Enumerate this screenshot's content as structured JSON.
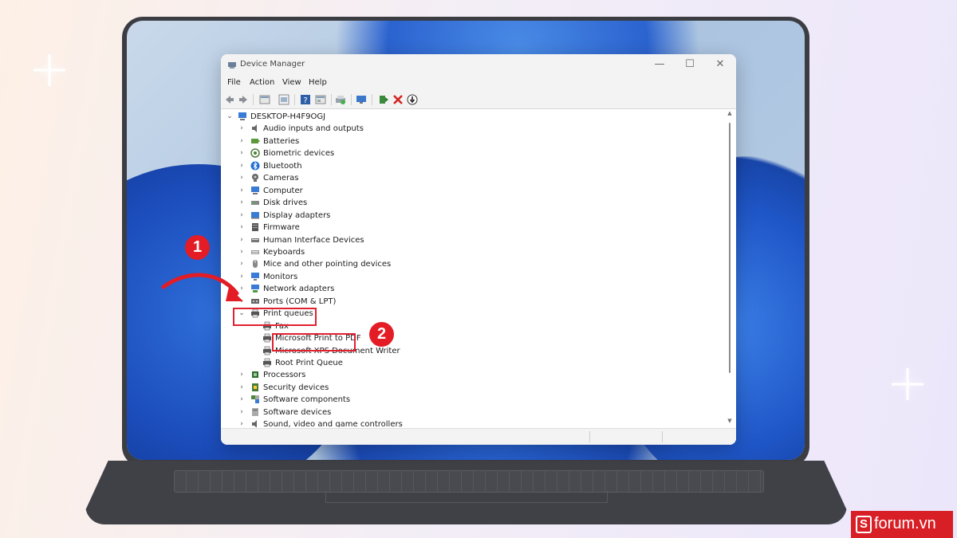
{
  "window": {
    "title": "Device Manager",
    "controls": {
      "minimize": "—",
      "maximize": "☐",
      "close": "✕"
    }
  },
  "menu": [
    "File",
    "Action",
    "View",
    "Help"
  ],
  "toolbar_icons": [
    "back-arrow-icon",
    "forward-arrow-icon",
    "properties-icon",
    "show-hidden-icon",
    "help-icon",
    "view-resources-icon",
    "update-driver-icon",
    "scan-hardware-icon",
    "enable-device-icon",
    "uninstall-icon",
    "disable-device-icon"
  ],
  "tree": {
    "root": "DESKTOP-H4F9OGJ",
    "categories": [
      {
        "label": "Audio inputs and outputs",
        "icon": "speaker-icon"
      },
      {
        "label": "Batteries",
        "icon": "battery-icon"
      },
      {
        "label": "Biometric devices",
        "icon": "fingerprint-icon"
      },
      {
        "label": "Bluetooth",
        "icon": "bluetooth-icon"
      },
      {
        "label": "Cameras",
        "icon": "camera-icon"
      },
      {
        "label": "Computer",
        "icon": "computer-icon"
      },
      {
        "label": "Disk drives",
        "icon": "disk-drive-icon"
      },
      {
        "label": "Display adapters",
        "icon": "display-adapter-icon"
      },
      {
        "label": "Firmware",
        "icon": "firmware-icon"
      },
      {
        "label": "Human Interface Devices",
        "icon": "hid-icon"
      },
      {
        "label": "Keyboards",
        "icon": "keyboard-icon"
      },
      {
        "label": "Mice and other pointing devices",
        "icon": "mouse-icon"
      },
      {
        "label": "Monitors",
        "icon": "monitor-icon"
      },
      {
        "label": "Network adapters",
        "icon": "network-adapter-icon"
      },
      {
        "label": "Ports (COM & LPT)",
        "icon": "port-icon"
      },
      {
        "label": "Print queues",
        "icon": "printer-icon",
        "expanded": true,
        "children": [
          "Fax",
          "Microsoft Print to PDF",
          "Microsoft XPS Document Writer",
          "Root Print Queue"
        ]
      },
      {
        "label": "Processors",
        "icon": "processor-icon"
      },
      {
        "label": "Security devices",
        "icon": "security-device-icon"
      },
      {
        "label": "Software components",
        "icon": "software-component-icon"
      },
      {
        "label": "Software devices",
        "icon": "software-device-icon"
      },
      {
        "label": "Sound, video and game controllers",
        "icon": "sound-controller-icon"
      }
    ]
  },
  "annotations": {
    "step1": "1",
    "step2": "2"
  },
  "brand": {
    "mark": "S",
    "text": "forum.vn"
  },
  "colors": {
    "accent_red": "#e31c25",
    "window_bg": "#ffffff",
    "chrome": "#f3f3f3"
  }
}
